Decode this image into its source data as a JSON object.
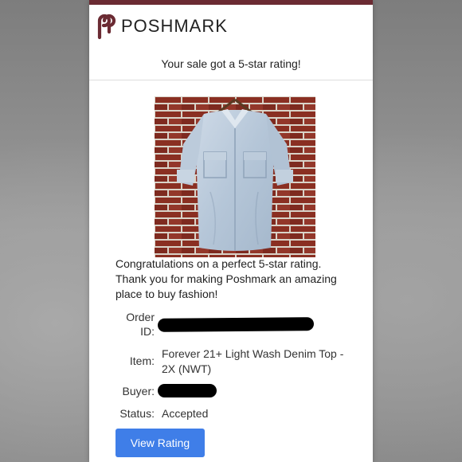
{
  "brand": {
    "name": "POSHMARK",
    "accent_color": "#6b2b33",
    "logo_icon": "poshmark-p-icon"
  },
  "email": {
    "headline": "Your sale got a 5-star rating!",
    "message_lines": [
      "Congratulations on a perfect 5-star rating.",
      "Thank you for making Poshmark an amazing",
      "place to buy fashion!"
    ],
    "details": {
      "order_label_line1": "Order",
      "order_label_line2": "ID:",
      "order_value": "[redacted]",
      "item_label": "Item:",
      "item_value_line1": "Forever 21+ Light Wash Denim Top -",
      "item_value_line2": "2X (NWT)",
      "buyer_label": "Buyer:",
      "buyer_value": "[redacted]",
      "status_label": "Status:",
      "status_value": "Accepted"
    },
    "button_label": "View Rating",
    "button_color": "#3f7ee8",
    "product_image": "denim-shirt-on-brick-wall-photo"
  }
}
